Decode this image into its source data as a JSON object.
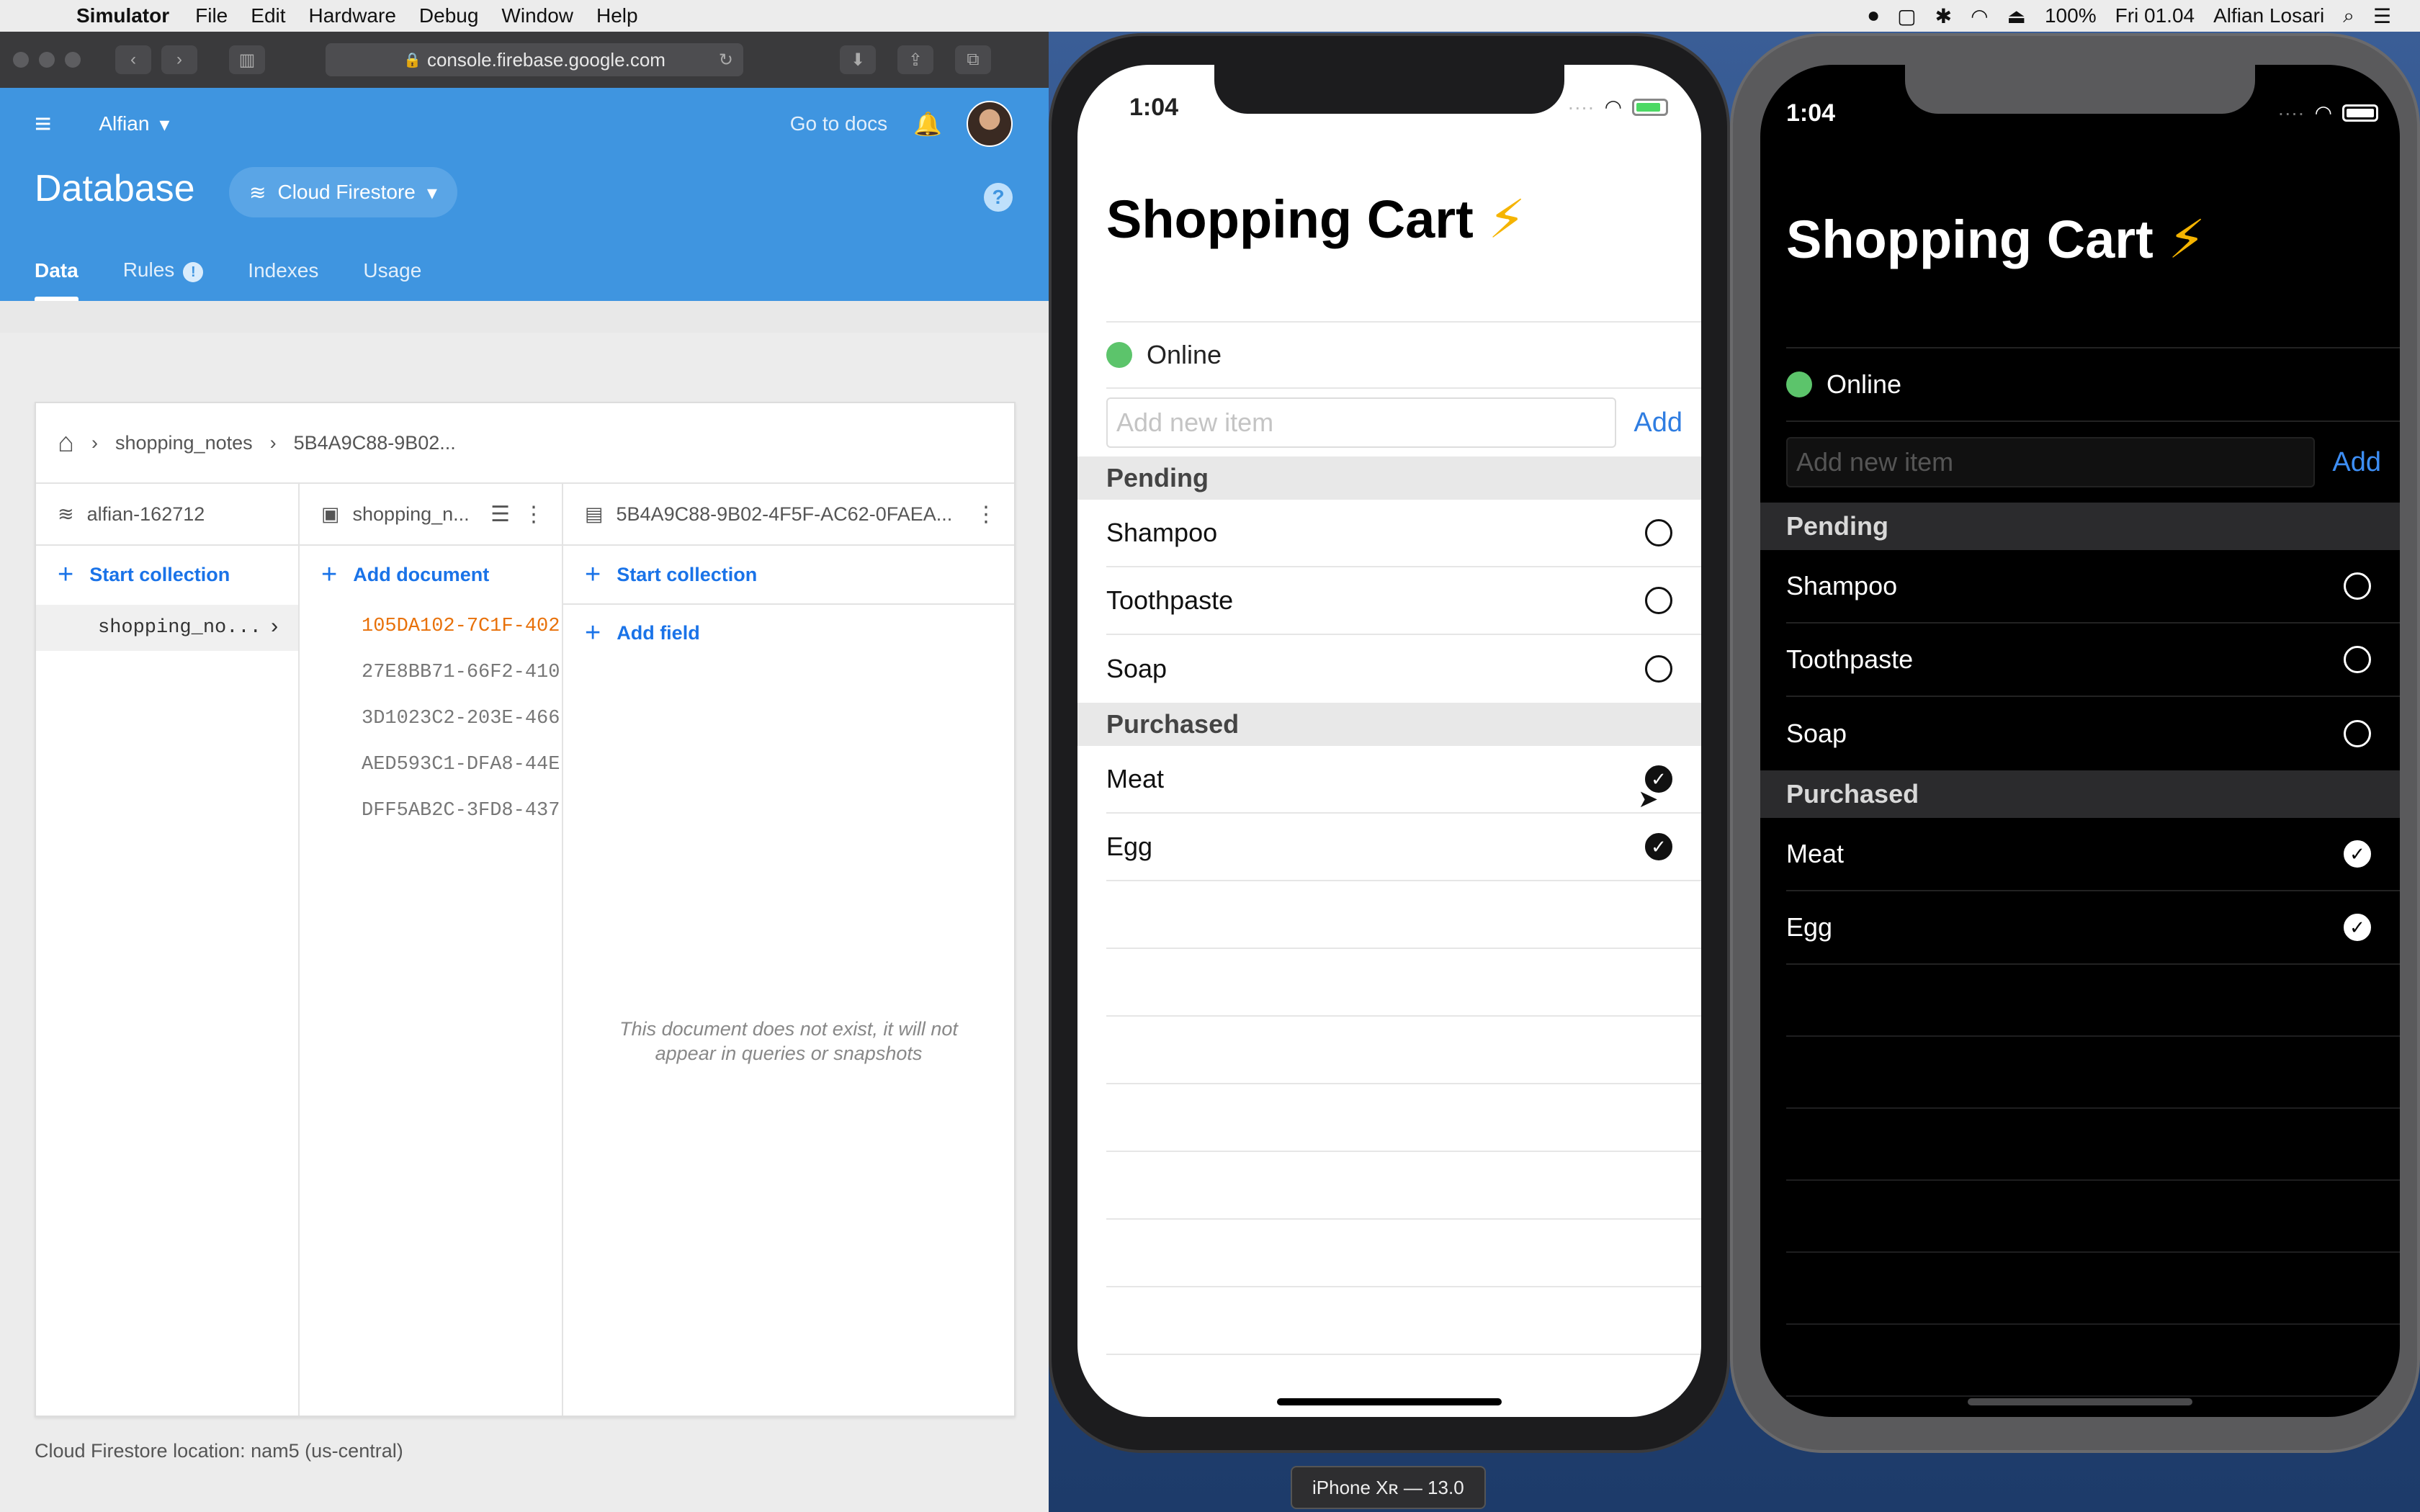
{
  "menubar": {
    "app_name": "Simulator",
    "items": [
      "File",
      "Edit",
      "Hardware",
      "Debug",
      "Window",
      "Help"
    ],
    "battery": "100%",
    "clock": "Fri 01.04",
    "user": "Alfian Losari"
  },
  "safari": {
    "url": "console.firebase.google.com"
  },
  "firebase": {
    "project": "Alfian",
    "go_to_docs": "Go to docs",
    "page_title": "Database",
    "product": "Cloud Firestore",
    "tabs": [
      "Data",
      "Rules",
      "Indexes",
      "Usage"
    ],
    "rules_badge": "!",
    "breadcrumb": [
      "shopping_notes",
      "5B4A9C88-9B02..."
    ],
    "columns": {
      "root": {
        "title": "alfian-162712",
        "action": "Start collection",
        "items": [
          "shopping_no..."
        ]
      },
      "collection": {
        "title": "shopping_n...",
        "action": "Add document",
        "items": [
          "105DA102-7C1F-402",
          "27E8BB71-66F2-410",
          "3D1023C2-203E-466",
          "AED593C1-DFA8-44E",
          "DFF5AB2C-3FD8-437"
        ]
      },
      "document": {
        "title": "5B4A9C88-9B02-4F5F-AC62-0FAEA...",
        "action": "Start collection",
        "action2": "Add field",
        "note": "This document does not exist, it will not appear in queries or snapshots"
      }
    },
    "location": "Cloud Firestore location: nam5 (us-central)"
  },
  "app": {
    "time": "1:04",
    "title": "Shopping Cart",
    "title_emoji": "⚡",
    "status": "Online",
    "input_placeholder": "Add new item",
    "add_label": "Add",
    "sections": {
      "pending_header": "Pending",
      "purchased_header": "Purchased"
    },
    "pending": [
      "Shampoo",
      "Toothpaste",
      "Soap"
    ],
    "purchased": [
      "Meat",
      "Egg"
    ],
    "check_glyph": "✓"
  },
  "simulator_label": "iPhone Xʀ — 13.0",
  "colors": {
    "firebase_blue": "#3f95e0",
    "online_green": "#5cc46b",
    "link_blue": "#1a73e8",
    "active_doc_orange": "#e8710a"
  }
}
